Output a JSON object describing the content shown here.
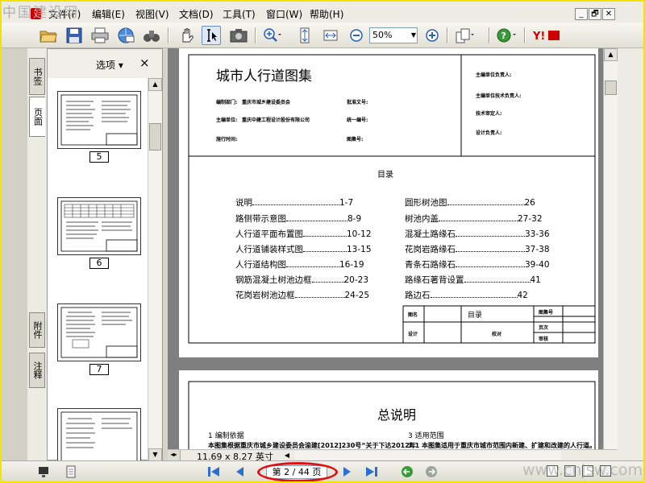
{
  "watermark_top": "中国建设网",
  "watermark_bottom": "www.cnjsw.com",
  "menu": [
    "文件(F)",
    "编辑(E)",
    "视图(V)",
    "文档(D)",
    "工具(T)",
    "窗口(W)",
    "帮助(H)"
  ],
  "window_controls": [
    "_",
    "🗗",
    "✕"
  ],
  "toolbar": {
    "zoom_value": "50%"
  },
  "sidetabs": {
    "bookmarks": "书签",
    "pages": "页面",
    "attachments": "附件",
    "comments": "注释"
  },
  "panel": {
    "options": "选项 ▾",
    "close": "×"
  },
  "thumbnails": [
    "5",
    "6",
    "7"
  ],
  "document": {
    "title": "城市人行道图集",
    "meta_left": [
      {
        "label": "编制部门:",
        "value": "重庆市城乡建设委员会"
      },
      {
        "label": "主编单位:",
        "value": "重庆中建工程设计股份有限公司"
      },
      {
        "label": "施行时间:",
        "value": ""
      }
    ],
    "meta_mid": [
      {
        "label": "批准文号:",
        "value": ""
      },
      {
        "label": "统一编号:",
        "value": ""
      },
      {
        "label": "图集号:",
        "value": ""
      }
    ],
    "meta_right": [
      "主编单位负责人:",
      "主编单位技术负责人:",
      "技术审定人:",
      "设计负责人:"
    ],
    "toc_heading": "目录",
    "toc_left": [
      {
        "name": "说明",
        "page": "1-7"
      },
      {
        "name": "路侧带示意图",
        "page": "8-9"
      },
      {
        "name": "人行道平面布置图",
        "page": "10-12"
      },
      {
        "name": "人行道铺装样式图",
        "page": "13-15"
      },
      {
        "name": "人行道结构图",
        "page": "16-19"
      },
      {
        "name": "钢筋混凝土树池边框",
        "page": "20-23"
      },
      {
        "name": "花岗岩树池边框",
        "page": "24-25"
      }
    ],
    "toc_right": [
      {
        "name": "圆形树池图",
        "page": "26"
      },
      {
        "name": "树池内盖",
        "page": "27-32"
      },
      {
        "name": "混凝土路缘石",
        "page": "33-36"
      },
      {
        "name": "花岗岩路缘石",
        "page": "37-38"
      },
      {
        "name": "青条石路缘石",
        "page": "39-40"
      },
      {
        "name": "路缘石著背设置",
        "page": "41"
      },
      {
        "name": "路边石",
        "page": "42"
      }
    ],
    "titleblock": {
      "name_label": "图名",
      "name": "目录",
      "atlas_no": "图集号",
      "page_no": "页次",
      "design": "设计",
      "check": "校对",
      "review": "审核"
    },
    "page2_title": "总说明",
    "page2_s1": "1  编制依据",
    "page2_s1_text": "本图集根据重庆市城乡建设委员会渝建[2012]230号“关于下达2012年",
    "page2_s3": "3  适用范围",
    "page2_s3_text": "3.1  本图集适用于重庆市城市范围内新建、扩建和改建的人行道。"
  },
  "status": {
    "dimensions": "11.69 x 8.27 英寸",
    "page_current": "2",
    "page_total": "44",
    "page_display": "第 2 / 44 页"
  }
}
